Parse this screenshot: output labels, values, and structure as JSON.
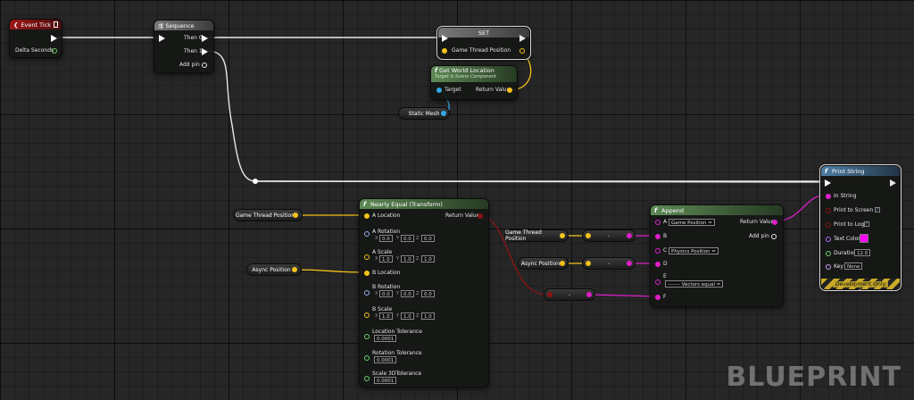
{
  "colors": {
    "exec": "#ffffff",
    "vector": "#f4c21b",
    "string": "#e01fc9",
    "object": "#33a7e8",
    "bool": "#8c1414",
    "float": "#6bd16b",
    "transform": "#f07a16",
    "rotator": "#9ab1f0",
    "link": "#c8a0ff"
  },
  "event_tick": {
    "title": "Event Tick",
    "delta": "Delta Seconds"
  },
  "sequence": {
    "title": "Sequence",
    "then0": "Then 0",
    "then1": "Then 1",
    "add_pin": "Add pin"
  },
  "set": {
    "title": "SET",
    "var": "Game Thread Position"
  },
  "get_world_location": {
    "title": "Get World Location",
    "subtitle": "Target is Scene Component",
    "target": "Target",
    "return": "Return Value"
  },
  "static_mesh": {
    "label": "Static Mesh"
  },
  "nearly_equal": {
    "title": "Nearly Equal (Transform)",
    "a_location": "A Location",
    "return": "Return Value",
    "a_rotation": "A Rotation",
    "a_scale": "A Scale",
    "b_location": "B Location",
    "b_rotation": "B Rotation",
    "b_scale": "B Scale",
    "loc_tol": "Location Tolerance",
    "rot_tol": "Rotation Tolerance",
    "scale_tol": "Scale 3DTolerance",
    "x": "X",
    "y": "Y",
    "z": "Z",
    "a_rot_vals": [
      "0.0",
      "0.0",
      "0.0"
    ],
    "a_scale_vals": [
      "1.0",
      "1.0",
      "1.0"
    ],
    "b_rot_vals": [
      "0.0",
      "0.0",
      "0.0"
    ],
    "b_scale_vals": [
      "1.0",
      "1.0",
      "1.0"
    ],
    "loc_tol_val": "0.0001",
    "rot_tol_val": "0.0001",
    "scale_tol_val": "0.0001"
  },
  "game_thread_var": {
    "label": "Game Thread Position"
  },
  "async_var": {
    "label": "Async Position"
  },
  "game_thread_var2": {
    "label": "Game Thread Position"
  },
  "async_var2": {
    "label": "Async Position"
  },
  "append": {
    "title": "Append",
    "a": "A",
    "a_val": "Game Position =",
    "return": "Return Value",
    "b": "B",
    "c": "C",
    "c_val": "Physics Position =",
    "d": "D",
    "e": "E",
    "e_val": "------- Vectors equal =",
    "f": "F",
    "add_pin": "Add pin"
  },
  "print_string": {
    "title": "Print String",
    "in_string": "In String",
    "print_screen": "Print to Screen",
    "print_log": "Print to Log",
    "text_color": "Text Color",
    "text_color_hex": "#ff00ff",
    "duration": "Duration",
    "duration_val": "12.0",
    "key": "Key",
    "key_val": "None",
    "dev_only": "Development Only",
    "screen_checked": true,
    "log_checked": true
  },
  "conv_bool_str": {
    "label": "●"
  },
  "watermark": "BLUEPRINT"
}
